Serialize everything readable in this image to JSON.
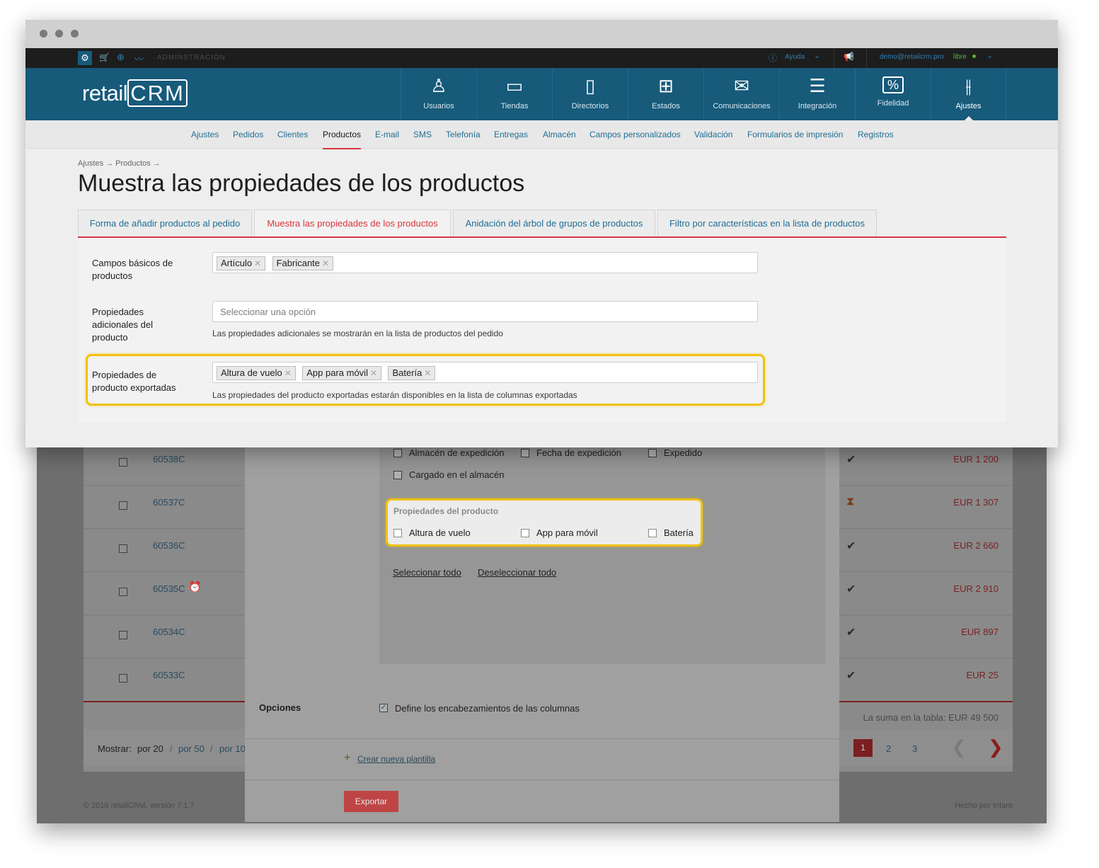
{
  "admin_bar": {
    "label": "ADMINSTRACIÓN",
    "help": "Ayuda",
    "user_email": "demo@retailcrm.pro",
    "plan": "libre"
  },
  "logo": {
    "text_light": "retail",
    "text_brand": "CRM"
  },
  "main_nav": [
    {
      "label": "Usuarios",
      "icon": "user-icon"
    },
    {
      "label": "Tiendas",
      "icon": "store-icon"
    },
    {
      "label": "Directorios",
      "icon": "directory-icon"
    },
    {
      "label": "Estados",
      "icon": "status-icon"
    },
    {
      "label": "Comunicaciones",
      "icon": "mail-icon"
    },
    {
      "label": "Integración",
      "icon": "integration-icon"
    },
    {
      "label": "Fidelidad",
      "icon": "loyalty-icon"
    },
    {
      "label": "Ajustes",
      "icon": "settings-sliders-icon"
    }
  ],
  "sub_nav": [
    "Ajustes",
    "Pedidos",
    "Clientes",
    "Productos",
    "E-mail",
    "SMS",
    "Telefonía",
    "Entregas",
    "Almacén",
    "Campos personalizados",
    "Validación",
    "Formularios de impresión",
    "Registros"
  ],
  "breadcrumb": "Ajustes → Productos →",
  "page_title": "Muestra las propiedades de los productos",
  "tabs": [
    "Forma de añadir productos al pedido",
    "Muestra las propiedades de los productos",
    "Anidación del árbol de grupos de productos",
    "Filtro por características en la lista de productos"
  ],
  "form": {
    "basic_fields": {
      "label": "Campos básicos de productos",
      "tags": [
        "Artículo",
        "Fabricante"
      ]
    },
    "additional": {
      "label": "Propiedades adicionales del producto",
      "placeholder": "Seleccionar una opción",
      "help": "Las propiedades adicionales se mostrarán en la lista de productos del pedido"
    },
    "exported": {
      "label": "Propiedades de producto exportadas",
      "tags": [
        "Altura de vuelo",
        "App para móvil",
        "Batería"
      ],
      "help": "Las propiedades del producto exportadas estarán disponibles en la lista de columnas exportadas"
    }
  },
  "orders": [
    {
      "number": "60538C",
      "price": "EUR 1 200"
    },
    {
      "number": "60537C",
      "price": "EUR 1 307"
    },
    {
      "number": "60536C",
      "price": "EUR 2 660"
    },
    {
      "number": "60535C",
      "price": "EUR 2 910"
    },
    {
      "number": "60534C",
      "price": "EUR 897"
    },
    {
      "number": "60533C",
      "price": "EUR 25"
    }
  ],
  "table_sum": "La suma en la tabla: EUR 49 500",
  "pager": {
    "show_label": "Mostrar:",
    "options": [
      "por 20",
      "por 50",
      "por 10"
    ],
    "pages": [
      "1",
      "2",
      "3"
    ]
  },
  "footer": {
    "left": "© 2018 retailCRM, versión 7.1.7",
    "right": "Hecho por Intaro"
  },
  "export_modal": {
    "fields": [
      "Almacén de expedición",
      "Fecha de expedición",
      "Expedido",
      "Cargado en el almacén"
    ],
    "product_props_title": "Propiedades del producto",
    "product_props": [
      "Altura de vuelo",
      "App para móvil",
      "Batería"
    ],
    "select_all": "Seleccionar todo",
    "deselect_all": "Deseleccionar todo",
    "options_label": "Opciones",
    "define_headers": "Define los encabezamientos de las columnas",
    "new_template": "Crear nueva plantilla",
    "export_button": "Exportar"
  },
  "colors": {
    "brand": "#175a7a",
    "accent": "#d9363e",
    "highlight": "#f0c20c",
    "link": "#1f6d94"
  }
}
